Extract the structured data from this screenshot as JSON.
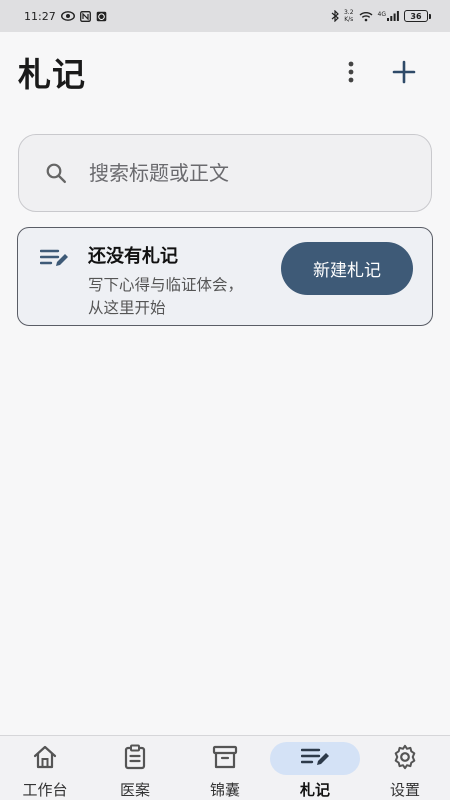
{
  "status_bar": {
    "time": "11:27",
    "net_speed_value": "3.2",
    "net_speed_unit": "K/s",
    "network_type": "4G",
    "battery": "36"
  },
  "header": {
    "title": "札记"
  },
  "search": {
    "placeholder": "搜索标题或正文"
  },
  "empty_state": {
    "title": "还没有札记",
    "description": "写下心得与临证体会，从这里开始",
    "button_label": "新建札记"
  },
  "bottom_nav": {
    "items": [
      {
        "label": "工作台",
        "icon": "home-icon"
      },
      {
        "label": "医案",
        "icon": "clipboard-icon"
      },
      {
        "label": "锦囊",
        "icon": "archive-icon"
      },
      {
        "label": "札记",
        "icon": "notes-edit-icon",
        "active": true
      },
      {
        "label": "设置",
        "icon": "gear-icon"
      }
    ]
  },
  "colors": {
    "accent": "#3e5a77",
    "active_nav_bg": "#d4e2f6"
  }
}
